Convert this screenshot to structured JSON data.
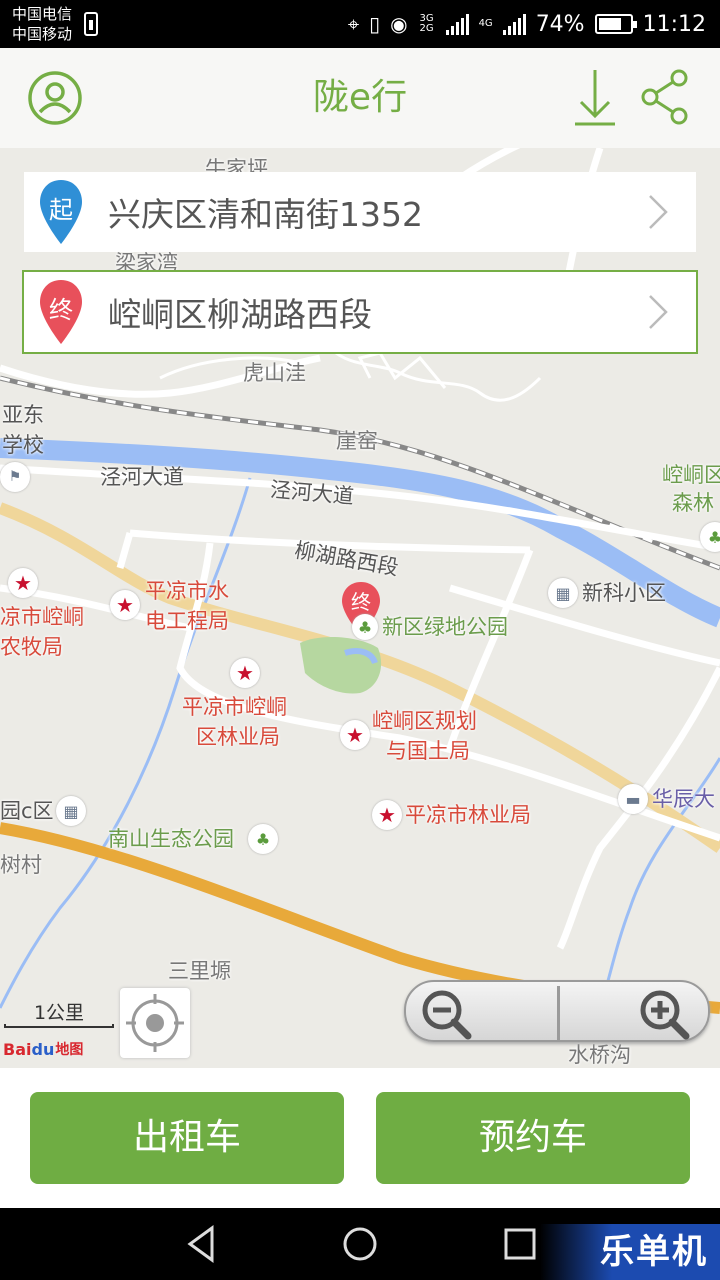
{
  "status_bar": {
    "carrier_1": "中国电信",
    "carrier_2": "中国移动",
    "network_1": "3G 2G",
    "network_2": "4G",
    "battery": "74%",
    "battery_level": 0.74,
    "time": "11:12"
  },
  "header": {
    "title": "陇e行",
    "left_icon": "user-profile-icon",
    "right_icons": [
      "download-icon",
      "share-icon"
    ],
    "accent_color": "#75ae45"
  },
  "route": {
    "start": {
      "badge": "起",
      "address": "兴庆区清和南街1352",
      "pin_color": "#2f8fd6"
    },
    "end": {
      "badge": "终",
      "address": "崆峒区柳湖路西段",
      "pin_color": "#e8505b"
    }
  },
  "map": {
    "labels": {
      "niujiaping": "牛家坪",
      "liangjiawan": "梁家湾",
      "hushanwa": "虎山洼",
      "yadong": "亚东",
      "xuexiao": "学校",
      "yaoyao": "崖窑",
      "jinghe_road_1": "泾河大道",
      "jinghe_road_2": "泾河大道",
      "kongtong_forest_1": "崆峒区",
      "kongtong_forest_2": "森林",
      "liuhu_road": "柳湖路西段",
      "xinke": "新科小区",
      "water_bureau_1": "平凉市水",
      "water_bureau_2": "电工程局",
      "agri_bureau_1": "凉市崆峒",
      "agri_bureau_2": "农牧局",
      "green_park": "新区绿地公园",
      "forestry_1": "平凉市崆峒",
      "forestry_2": "区林业局",
      "planning_1": "崆峒区规划",
      "planning_2": "与国土局",
      "huachen": "华辰大",
      "c_district": "园c区",
      "nanshan_park": "南山生态公园",
      "city_forestry": "平凉市林业局",
      "shu_village": "树村",
      "sanliyuan": "三里塬",
      "shuiqiaogou": "水桥沟"
    },
    "end_marker_badge": "终",
    "scale_label": "1公里",
    "logo": {
      "part1": "Bai",
      "part2": "du",
      "part3": "地图"
    },
    "controls": [
      "locate-icon",
      "zoom-out-icon",
      "zoom-in-icon"
    ]
  },
  "actions": {
    "taxi_label": "出租车",
    "booking_label": "预约车",
    "button_color": "#6fad43"
  },
  "nav_bar": {
    "icons": [
      "back-icon",
      "home-icon",
      "recent-apps-icon"
    ],
    "watermark": "乐单机"
  }
}
